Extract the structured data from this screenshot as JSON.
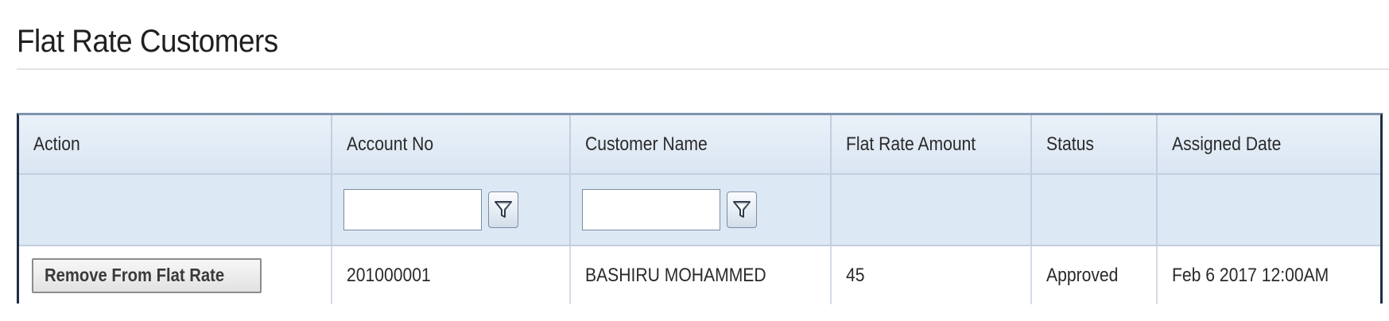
{
  "page": {
    "title": "Flat Rate Customers"
  },
  "grid": {
    "columns": [
      {
        "key": "action",
        "label": "Action"
      },
      {
        "key": "account_no",
        "label": "Account No"
      },
      {
        "key": "customer_name",
        "label": "Customer Name"
      },
      {
        "key": "flat_rate_amount",
        "label": "Flat Rate Amount"
      },
      {
        "key": "status",
        "label": "Status"
      },
      {
        "key": "assigned_date",
        "label": "Assigned Date"
      }
    ],
    "filters": {
      "account_no": {
        "value": "",
        "icon": "filter-funnel-icon"
      },
      "customer_name": {
        "value": "",
        "icon": "filter-funnel-icon"
      }
    },
    "rows": [
      {
        "action_label": "Remove From Flat Rate",
        "account_no": "201000001",
        "customer_name": "BASHIRU MOHAMMED",
        "flat_rate_amount": "45",
        "status": "Approved",
        "assigned_date": "Feb 6 2017 12:00AM"
      }
    ]
  },
  "colors": {
    "header_bg": "#dae6f3",
    "filter_row_bg": "#dde8f5",
    "grid_border": "#1f2e44"
  }
}
